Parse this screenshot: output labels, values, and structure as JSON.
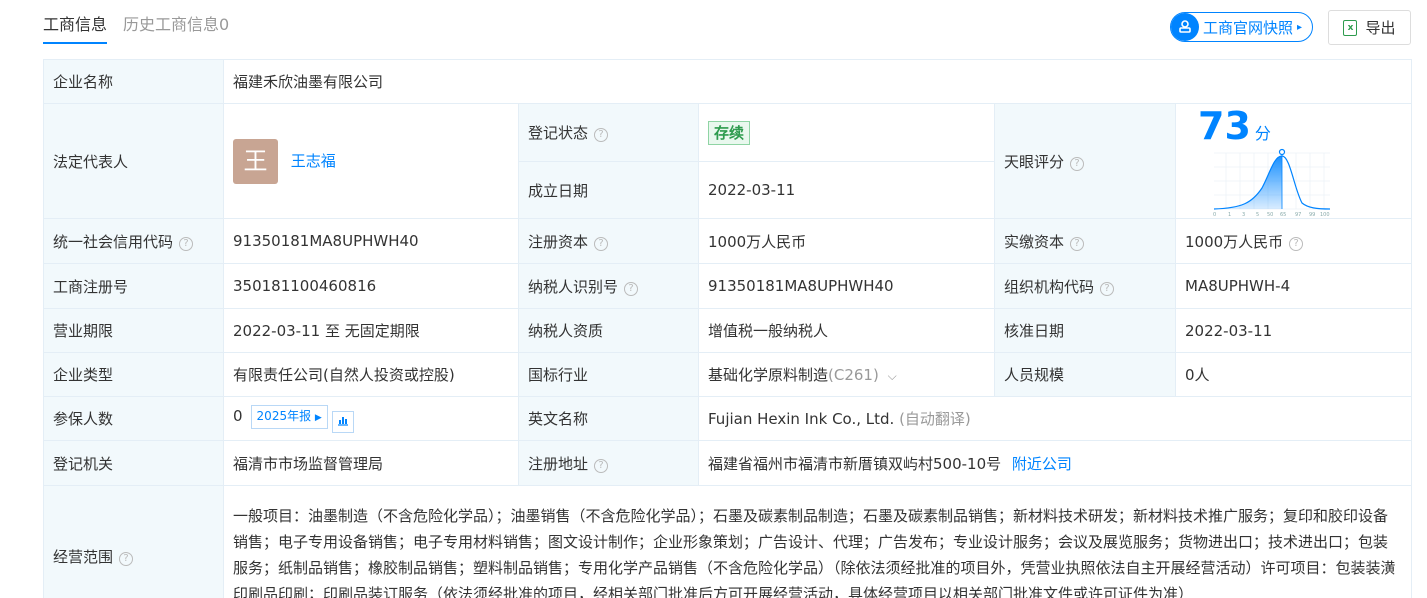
{
  "tabs": [
    {
      "label": "工商信息"
    },
    {
      "label": "历史工商信息0"
    }
  ],
  "snapshot_label": "工商官网快照",
  "export_label": "导出",
  "rows": {
    "company_name": {
      "key": "企业名称",
      "value": "福建禾欣油墨有限公司"
    },
    "legal_rep": {
      "key": "法定代表人",
      "avatar_char": "王",
      "name": "王志福"
    },
    "reg_status": {
      "key": "登记状态",
      "value": "存续"
    },
    "est_date": {
      "key": "成立日期",
      "value": "2022-03-11"
    },
    "tianyan_score": {
      "key": "天眼评分",
      "score": "73",
      "unit": "分",
      "axis_ticks": [
        "0",
        "1",
        "3",
        "5",
        "50",
        "65",
        "97",
        "99",
        "100"
      ]
    },
    "credit_code": {
      "key": "统一社会信用代码",
      "value": "91350181MA8UPHWH40"
    },
    "reg_capital": {
      "key": "注册资本",
      "value": "1000万人民币"
    },
    "paid_capital": {
      "key": "实缴资本",
      "value": "1000万人民币"
    },
    "biz_reg_no": {
      "key": "工商注册号",
      "value": "350181100460816"
    },
    "taxpayer_id": {
      "key": "纳税人识别号",
      "value": "91350181MA8UPHWH40"
    },
    "org_code": {
      "key": "组织机构代码",
      "value": "MA8UPHWH-4"
    },
    "biz_term": {
      "key": "营业期限",
      "value": "2022-03-11 至 无固定期限"
    },
    "taxpayer_qual": {
      "key": "纳税人资质",
      "value": "增值税一般纳税人"
    },
    "approval_date": {
      "key": "核准日期",
      "value": "2022-03-11"
    },
    "company_type": {
      "key": "企业类型",
      "value": "有限责任公司(自然人投资或控股)"
    },
    "industry": {
      "key": "国标行业",
      "value": "基础化学原料制造",
      "code": "(C261)"
    },
    "staff_size": {
      "key": "人员规模",
      "value": "0人"
    },
    "insured": {
      "key": "参保人数",
      "value": "0",
      "badge": "2025年报"
    },
    "english_name": {
      "key": "英文名称",
      "value": "Fujian Hexin Ink Co., Ltd.",
      "note": "(自动翻译)"
    },
    "reg_authority": {
      "key": "登记机关",
      "value": "福清市市场监督管理局"
    },
    "reg_address": {
      "key": "注册地址",
      "value": "福建省福州市福清市新厝镇双屿村500-10号",
      "link": "附近公司"
    },
    "biz_scope": {
      "key": "经营范围",
      "value": "一般项目：油墨制造（不含危险化学品）；油墨销售（不含危险化学品）；石墨及碳素制品制造；石墨及碳素制品销售；新材料技术研发；新材料技术推广服务；复印和胶印设备销售；电子专用设备销售；电子专用材料销售；图文设计制作；企业形象策划；广告设计、代理；广告发布；专业设计服务；会议及展览服务；货物进出口；技术进出口；包装服务；纸制品销售；橡胶制品销售；塑料制品销售；专用化学产品销售（不含危险化学品）（除依法须经批准的项目外，凭营业执照依法自主开展经营活动）许可项目：包装装潢印刷品印刷；印刷品装订服务（依法须经批准的项目，经相关部门批准后方可开展经营活动，具体经营项目以相关部门批准文件或许可证件为准）"
    }
  },
  "colors": {
    "accent": "#0084ff",
    "key_bg": "#f2f9fc",
    "status_green": "#2e9b4e"
  }
}
